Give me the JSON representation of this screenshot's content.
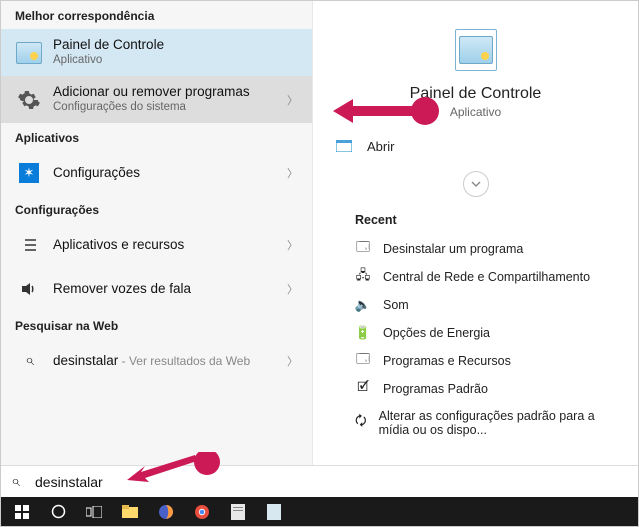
{
  "sections": {
    "best_match": "Melhor correspondência",
    "apps": "Aplicativos",
    "settings": "Configurações",
    "web": "Pesquisar na Web"
  },
  "results": {
    "best": {
      "title": "Painel de Controle",
      "subtitle": "Aplicativo"
    },
    "selected": {
      "title": "Adicionar ou remover programas",
      "subtitle": "Configurações do sistema"
    },
    "apps": [
      {
        "title": "Configurações"
      }
    ],
    "settings": [
      {
        "title": "Aplicativos e recursos"
      },
      {
        "title": "Remover vozes de fala"
      }
    ],
    "web": {
      "term": "desinstalar",
      "suffix": " - Ver resultados da Web"
    }
  },
  "preview": {
    "title": "Painel de Controle",
    "subtitle": "Aplicativo",
    "open": "Abrir",
    "recent_label": "Recent",
    "recent": [
      "Desinstalar um programa",
      "Central de Rede e Compartilhamento",
      "Som",
      "Opções de Energia",
      "Programas e Recursos",
      "Programas Padrão",
      "Alterar as configurações padrão para a mídia ou os dispo..."
    ]
  },
  "search": {
    "value": "desinstalar"
  }
}
